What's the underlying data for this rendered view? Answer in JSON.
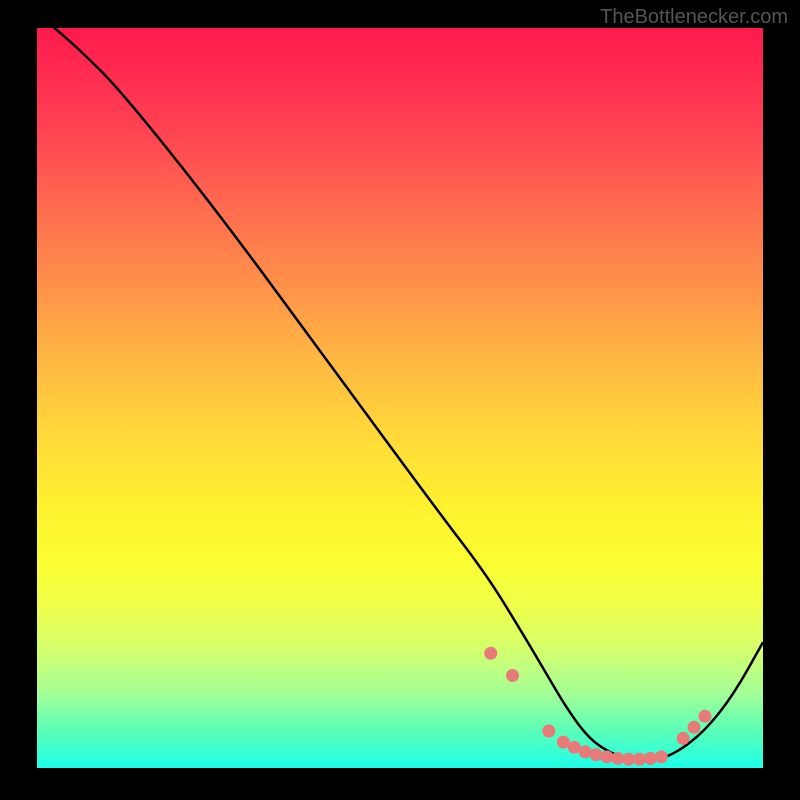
{
  "watermark": "TheBottlenecker.com",
  "chart_data": {
    "type": "line",
    "title": "",
    "xlabel": "",
    "ylabel": "",
    "xlim": [
      0,
      100
    ],
    "ylim": [
      0,
      100
    ],
    "series": [
      {
        "name": "curve",
        "x": [
          0,
          6,
          12,
          25,
          40,
          55,
          62,
          67,
          70,
          73,
          76,
          79,
          82,
          85,
          88,
          92,
          96,
          100
        ],
        "y": [
          102,
          97,
          91,
          75,
          55,
          35,
          26,
          18,
          13,
          8,
          4,
          2,
          1,
          1,
          2,
          5,
          10,
          17
        ]
      }
    ],
    "markers": {
      "x": [
        62.5,
        65.5,
        70.5,
        72.5,
        74,
        75.5,
        77,
        78.5,
        80,
        81.5,
        83,
        84.5,
        86,
        89,
        90.5,
        92
      ],
      "y": [
        15.5,
        12.5,
        5,
        3.5,
        2.8,
        2.2,
        1.8,
        1.5,
        1.3,
        1.2,
        1.2,
        1.3,
        1.5,
        4,
        5.5,
        7
      ]
    },
    "marker_color": "#e87a7a",
    "line_color": "#000000"
  }
}
